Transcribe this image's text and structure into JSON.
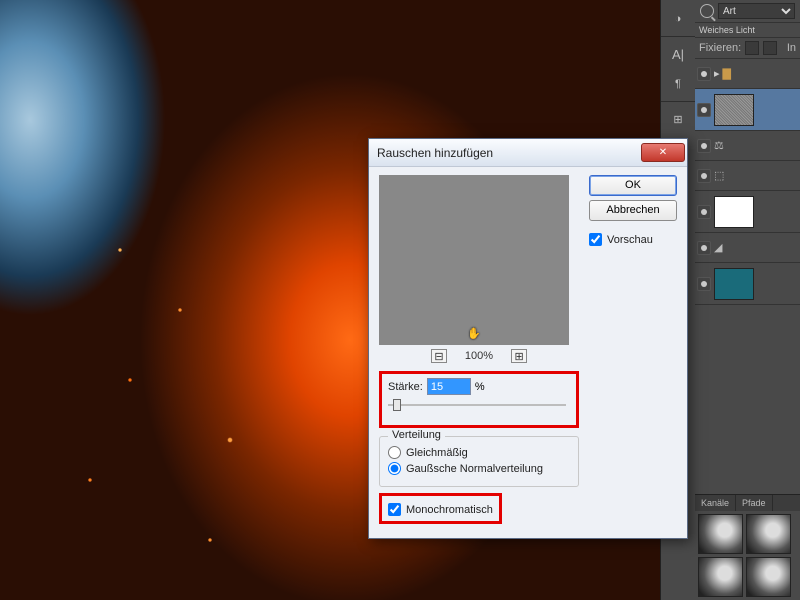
{
  "panels": {
    "search_label": "Art",
    "blend_mode": "Weiches Licht",
    "fix_label": "Fixieren:",
    "fill_label": "In",
    "tabs": {
      "channels": "Kanäle",
      "paths": "Pfade"
    }
  },
  "dialog": {
    "title": "Rauschen hinzufügen",
    "ok": "OK",
    "cancel": "Abbrechen",
    "preview_chk": "Vorschau",
    "zoom_value": "100%",
    "amount_label": "Stärke:",
    "amount_value": "15",
    "amount_unit": "%",
    "slider_pos_pct": 3,
    "distribution": {
      "legend": "Verteilung",
      "uniform": "Gleichmäßig",
      "gaussian": "Gaußsche Normalverteilung",
      "selected": "gaussian"
    },
    "mono_label": "Monochromatisch",
    "mono_checked": true
  }
}
